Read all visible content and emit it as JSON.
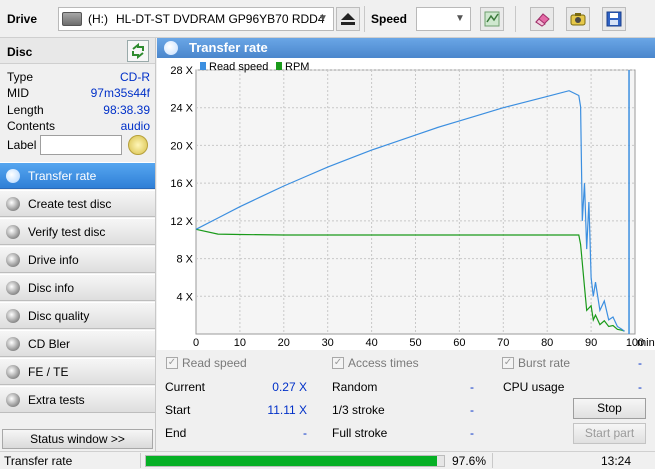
{
  "toolbar": {
    "drive_label": "Drive",
    "drive_letter": "(H:)",
    "drive_name": "HL-DT-ST DVDRAM GP96YB70 RDD4",
    "speed_label": "Speed",
    "speed_value": ""
  },
  "disc": {
    "title": "Disc",
    "rows": [
      {
        "key": "Type",
        "value": "CD-R"
      },
      {
        "key": "MID",
        "value": "97m35s44f"
      },
      {
        "key": "Length",
        "value": "98:38.39"
      },
      {
        "key": "Contents",
        "value": "audio"
      }
    ],
    "label_key": "Label",
    "label_value": ""
  },
  "nav": {
    "items": [
      {
        "label": "Transfer rate",
        "active": true
      },
      {
        "label": "Create test disc"
      },
      {
        "label": "Verify test disc"
      },
      {
        "label": "Drive info"
      },
      {
        "label": "Disc info"
      },
      {
        "label": "Disc quality"
      },
      {
        "label": "CD Bler"
      },
      {
        "label": "FE / TE"
      },
      {
        "label": "Extra tests"
      }
    ],
    "status_window": "Status window >>"
  },
  "chart_header": {
    "title": "Transfer rate"
  },
  "chart_data": {
    "type": "line",
    "x_unit": "min",
    "xlim": [
      0,
      100
    ],
    "ylim": [
      0,
      28
    ],
    "x_ticks": [
      0,
      10,
      20,
      30,
      40,
      50,
      60,
      70,
      80,
      90,
      100
    ],
    "y_ticks": [
      4,
      8,
      12,
      16,
      20,
      24,
      28
    ],
    "y_tick_labels": [
      "4 X",
      "8 X",
      "12 X",
      "16 X",
      "20 X",
      "24 X",
      "28 X"
    ],
    "grid": true,
    "legend_placement": "top-left",
    "series": [
      {
        "name": "Read speed",
        "color": "#3c8fe0",
        "x": [
          0,
          5,
          10,
          15,
          20,
          25,
          30,
          35,
          40,
          45,
          50,
          55,
          60,
          65,
          70,
          75,
          80,
          85,
          87.2,
          87.6,
          88,
          88.5,
          89,
          89.5,
          90,
          90.5,
          91,
          92,
          93,
          94,
          95,
          96,
          97,
          97.6
        ],
        "y": [
          11.1,
          12.3,
          13.5,
          14.6,
          15.7,
          16.7,
          17.7,
          18.6,
          19.5,
          20.3,
          21.1,
          21.9,
          22.6,
          23.3,
          24.0,
          24.6,
          25.2,
          25.8,
          25.3,
          24.1,
          12.0,
          16.0,
          9.0,
          14.0,
          6.0,
          4.0,
          5.5,
          2.5,
          3.5,
          1.5,
          1.8,
          0.8,
          0.5,
          0.3
        ]
      },
      {
        "name": "RPM",
        "color": "#1a9a1a",
        "x": [
          0,
          5,
          10,
          20,
          30,
          40,
          50,
          60,
          70,
          80,
          87.2,
          87.6,
          88.5,
          89,
          90,
          90.5,
          91,
          92,
          93,
          94,
          95,
          96,
          97,
          97.6
        ],
        "y": [
          11.1,
          10.6,
          10.55,
          10.5,
          10.5,
          10.5,
          10.5,
          10.5,
          10.5,
          10.5,
          10.5,
          9.5,
          5.0,
          2.5,
          3.0,
          1.5,
          2.0,
          1.0,
          1.4,
          0.8,
          0.9,
          0.5,
          0.4,
          0.3
        ]
      }
    ],
    "end_marker_x": 98.64
  },
  "stats": {
    "checks": {
      "read_speed": "Read speed",
      "access_times": "Access times",
      "burst_rate": "Burst rate"
    },
    "current_label": "Current",
    "current_value": "0.27 X",
    "start_label": "Start",
    "start_value": "11.11 X",
    "end_label": "End",
    "end_value": "-",
    "random_label": "Random",
    "random_value": "-",
    "one_third_label": "1/3 stroke",
    "one_third_value": "-",
    "full_stroke_label": "Full stroke",
    "full_stroke_value": "-",
    "cpu_label": "CPU usage",
    "cpu_value": "-",
    "burst_value": "-",
    "stop_button": "Stop",
    "start_part_button": "Start part"
  },
  "statusbar": {
    "text": "Transfer rate",
    "progress_fraction": 0.976,
    "percent": "97.6%",
    "time": "13:24"
  }
}
